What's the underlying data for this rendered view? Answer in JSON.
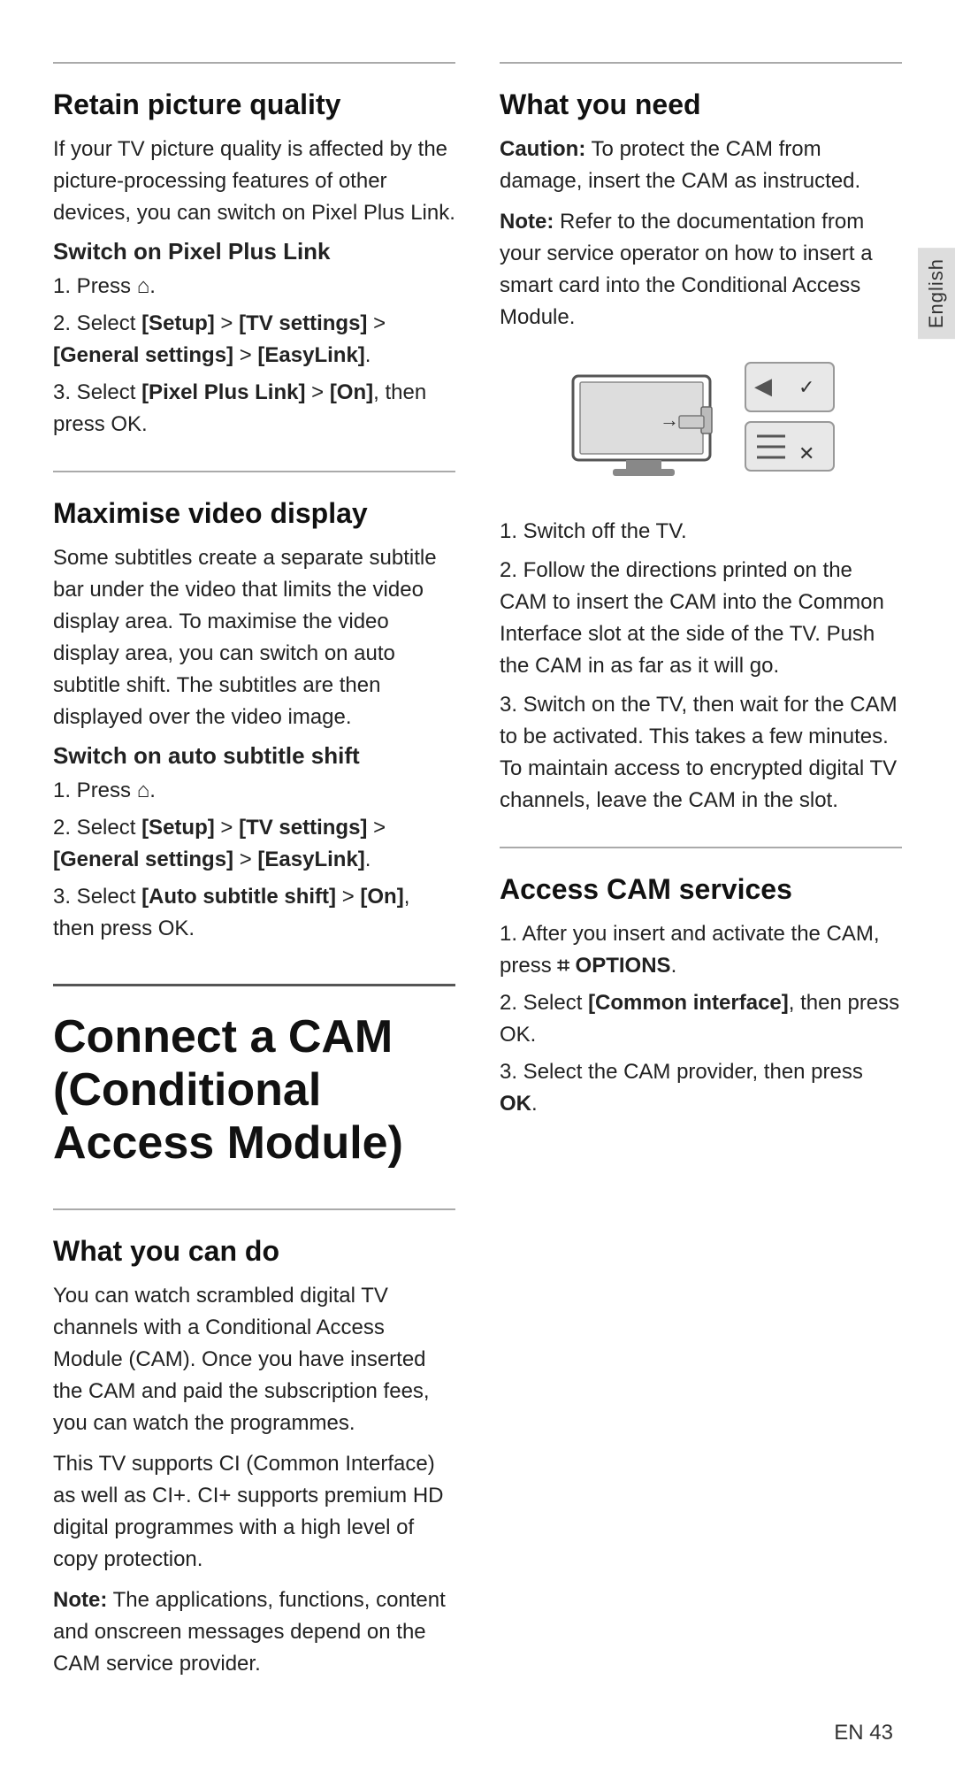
{
  "english_tab": "English",
  "left_column": {
    "retain_section": {
      "title": "Retain picture quality",
      "body": "If your TV picture quality is affected by the picture-processing features of other devices, you can switch on Pixel Plus Link.",
      "subsection_title": "Switch on Pixel Plus Link",
      "steps": [
        "1. Press ⌂.",
        "2. Select [Setup] > [TV settings] > [General settings] > [EasyLink].",
        "3. Select [Pixel Plus Link] > [On], then press OK."
      ]
    },
    "maximise_section": {
      "title": "Maximise video display",
      "body": "Some subtitles create a separate subtitle bar under the video that limits the video display area. To maximise the video display area, you can switch on auto subtitle shift. The subtitles are then displayed over the video image.",
      "subsection_title": "Switch on auto subtitle shift",
      "steps": [
        "1. Press ⌂.",
        "2. Select [Setup] > [TV settings] > [General settings] > [EasyLink].",
        "3. Select [Auto subtitle shift] > [On], then press OK."
      ]
    },
    "connect_section": {
      "title": "Connect a CAM (Conditional Access Module)"
    },
    "what_you_can_do": {
      "title": "What you can do",
      "body1": "You can watch scrambled digital TV channels with a Conditional Access Module (CAM). Once you have inserted the CAM and paid the subscription fees, you can watch the programmes.",
      "body2": "This TV supports CI (Common Interface) as well as CI+. CI+ supports premium HD digital programmes with a high level of copy protection.",
      "note_label": "Note:",
      "note_text": "The applications, functions, content and onscreen messages depend on the CAM service provider."
    }
  },
  "right_column": {
    "what_you_need": {
      "title": "What you need",
      "caution_label": "Caution:",
      "caution_text": "To protect the CAM from damage, insert the CAM as instructed.",
      "note_label": "Note:",
      "note_text": "Refer to the documentation from your service operator on how to insert a smart card into the Conditional Access Module."
    },
    "cam_steps": [
      "1. Switch off the TV.",
      "2. Follow the directions printed on the CAM to insert the CAM into the Common Interface slot at the side of the TV. Push the CAM in as far as it will go.",
      "3. Switch on the TV, then wait for the CAM to be activated. This takes a few minutes. To maintain access to encrypted digital TV channels, leave the CAM in the slot."
    ],
    "access_cam_services": {
      "title": "Access CAM services",
      "steps": [
        "1. After you insert and activate the CAM, press ☷ OPTIONS.",
        "2. Select [Common interface], then press OK.",
        "3. Select the CAM provider, then press OK."
      ]
    }
  },
  "footer": {
    "text": "EN  43"
  }
}
